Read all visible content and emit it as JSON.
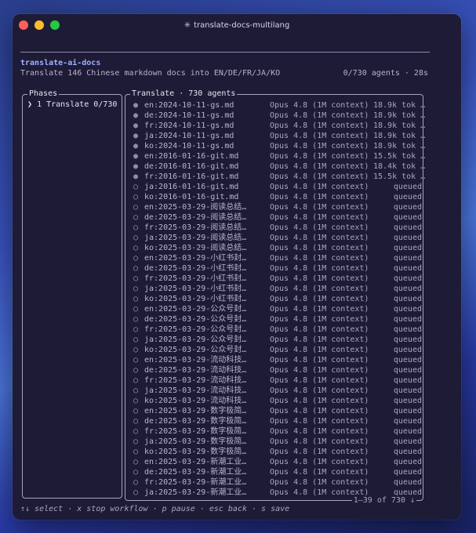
{
  "window": {
    "title": "translate-docs-multilang",
    "title_icon": "spinner-icon"
  },
  "header": {
    "app_name": "translate-ai-docs",
    "description": "Translate 146 Chinese markdown docs into EN/DE/FR/JA/KO",
    "status": "0/730 agents · 28s"
  },
  "phases": {
    "title": "Phases",
    "items": [
      {
        "chevron": "❯",
        "label": "1 Translate 0/730"
      }
    ]
  },
  "translate": {
    "title": "Translate · 730 agents",
    "range": "1–39 of 730 ↓",
    "rows": [
      {
        "status": "●",
        "file": "en:2024-10-11-gs.md",
        "model": "Opus 4.8 (1M context)",
        "result": "18.9k tok …"
      },
      {
        "status": "●",
        "file": "de:2024-10-11-gs.md",
        "model": "Opus 4.8 (1M context)",
        "result": "18.9k tok …"
      },
      {
        "status": "●",
        "file": "fr:2024-10-11-gs.md",
        "model": "Opus 4.8 (1M context)",
        "result": "18.9k tok …"
      },
      {
        "status": "●",
        "file": "ja:2024-10-11-gs.md",
        "model": "Opus 4.8 (1M context)",
        "result": "18.9k tok …"
      },
      {
        "status": "●",
        "file": "ko:2024-10-11-gs.md",
        "model": "Opus 4.8 (1M context)",
        "result": "18.9k tok …"
      },
      {
        "status": "●",
        "file": "en:2016-01-16-git.md",
        "model": "Opus 4.8 (1M context)",
        "result": "15.5k tok …"
      },
      {
        "status": "●",
        "file": "de:2016-01-16-git.md",
        "model": "Opus 4.8 (1M context)",
        "result": "18.4k tok …"
      },
      {
        "status": "●",
        "file": "fr:2016-01-16-git.md",
        "model": "Opus 4.8 (1M context)",
        "result": "15.5k tok …"
      },
      {
        "status": "○",
        "file": "ja:2016-01-16-git.md",
        "model": "Opus 4.8 (1M context)",
        "result": "queued"
      },
      {
        "status": "○",
        "file": "ko:2016-01-16-git.md",
        "model": "Opus 4.8 (1M context)",
        "result": "queued"
      },
      {
        "status": "○",
        "file": "en:2025-03-29-阅读总结…",
        "model": "Opus 4.8 (1M context)",
        "result": "queued"
      },
      {
        "status": "○",
        "file": "de:2025-03-29-阅读总结…",
        "model": "Opus 4.8 (1M context)",
        "result": "queued"
      },
      {
        "status": "○",
        "file": "fr:2025-03-29-阅读总结…",
        "model": "Opus 4.8 (1M context)",
        "result": "queued"
      },
      {
        "status": "○",
        "file": "ja:2025-03-29-阅读总结…",
        "model": "Opus 4.8 (1M context)",
        "result": "queued"
      },
      {
        "status": "○",
        "file": "ko:2025-03-29-阅读总结…",
        "model": "Opus 4.8 (1M context)",
        "result": "queued"
      },
      {
        "status": "○",
        "file": "en:2025-03-29-小红书封…",
        "model": "Opus 4.8 (1M context)",
        "result": "queued"
      },
      {
        "status": "○",
        "file": "de:2025-03-29-小红书封…",
        "model": "Opus 4.8 (1M context)",
        "result": "queued"
      },
      {
        "status": "○",
        "file": "fr:2025-03-29-小红书封…",
        "model": "Opus 4.8 (1M context)",
        "result": "queued"
      },
      {
        "status": "○",
        "file": "ja:2025-03-29-小红书封…",
        "model": "Opus 4.8 (1M context)",
        "result": "queued"
      },
      {
        "status": "○",
        "file": "ko:2025-03-29-小红书封…",
        "model": "Opus 4.8 (1M context)",
        "result": "queued"
      },
      {
        "status": "○",
        "file": "en:2025-03-29-公众号封…",
        "model": "Opus 4.8 (1M context)",
        "result": "queued"
      },
      {
        "status": "○",
        "file": "de:2025-03-29-公众号封…",
        "model": "Opus 4.8 (1M context)",
        "result": "queued"
      },
      {
        "status": "○",
        "file": "fr:2025-03-29-公众号封…",
        "model": "Opus 4.8 (1M context)",
        "result": "queued"
      },
      {
        "status": "○",
        "file": "ja:2025-03-29-公众号封…",
        "model": "Opus 4.8 (1M context)",
        "result": "queued"
      },
      {
        "status": "○",
        "file": "ko:2025-03-29-公众号封…",
        "model": "Opus 4.8 (1M context)",
        "result": "queued"
      },
      {
        "status": "○",
        "file": "en:2025-03-29-流动科技…",
        "model": "Opus 4.8 (1M context)",
        "result": "queued"
      },
      {
        "status": "○",
        "file": "de:2025-03-29-流动科技…",
        "model": "Opus 4.8 (1M context)",
        "result": "queued"
      },
      {
        "status": "○",
        "file": "fr:2025-03-29-流动科技…",
        "model": "Opus 4.8 (1M context)",
        "result": "queued"
      },
      {
        "status": "○",
        "file": "ja:2025-03-29-流动科技…",
        "model": "Opus 4.8 (1M context)",
        "result": "queued"
      },
      {
        "status": "○",
        "file": "ko:2025-03-29-流动科技…",
        "model": "Opus 4.8 (1M context)",
        "result": "queued"
      },
      {
        "status": "○",
        "file": "en:2025-03-29-数字极简…",
        "model": "Opus 4.8 (1M context)",
        "result": "queued"
      },
      {
        "status": "○",
        "file": "de:2025-03-29-数字极简…",
        "model": "Opus 4.8 (1M context)",
        "result": "queued"
      },
      {
        "status": "○",
        "file": "fr:2025-03-29-数字极简…",
        "model": "Opus 4.8 (1M context)",
        "result": "queued"
      },
      {
        "status": "○",
        "file": "ja:2025-03-29-数字极简…",
        "model": "Opus 4.8 (1M context)",
        "result": "queued"
      },
      {
        "status": "○",
        "file": "ko:2025-03-29-数字极简…",
        "model": "Opus 4.8 (1M context)",
        "result": "queued"
      },
      {
        "status": "○",
        "file": "en:2025-03-29-新潮工业…",
        "model": "Opus 4.8 (1M context)",
        "result": "queued"
      },
      {
        "status": "○",
        "file": "de:2025-03-29-新潮工业…",
        "model": "Opus 4.8 (1M context)",
        "result": "queued"
      },
      {
        "status": "○",
        "file": "fr:2025-03-29-新潮工业…",
        "model": "Opus 4.8 (1M context)",
        "result": "queued"
      },
      {
        "status": "○",
        "file": "ja:2025-03-29-新潮工业…",
        "model": "Opus 4.8 (1M context)",
        "result": "queued"
      }
    ]
  },
  "footer": {
    "hints": "↑↓ select · x stop workflow · p pause · esc back · s save"
  },
  "colors": {
    "window_bg": "#1e1b37",
    "accent": "#9fb0ff",
    "text": "#a9a6bd",
    "border": "#a7a4bd"
  }
}
